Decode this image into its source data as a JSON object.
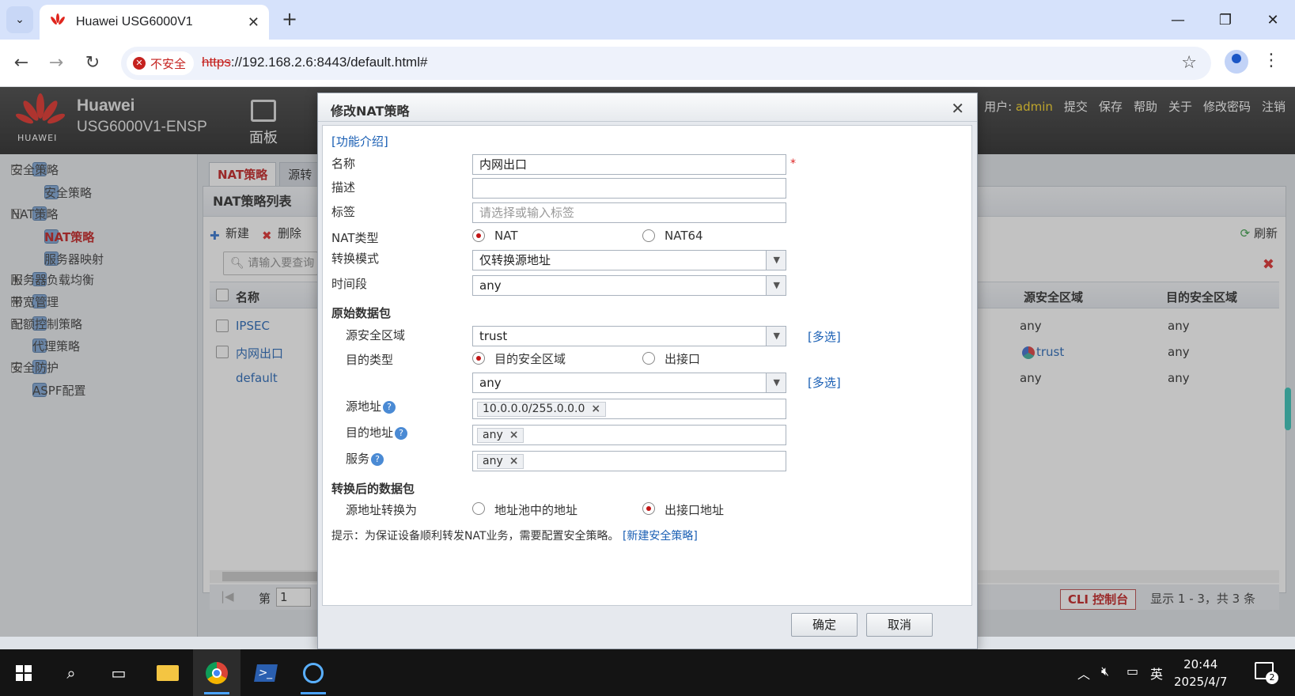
{
  "browser": {
    "tab_title": "Huawei USG6000V1",
    "security_label": "不安全",
    "url_scheme": "https",
    "url_rest": "://192.168.2.6:8443/default.html#"
  },
  "app": {
    "logo_text": "HUAWEI",
    "brand_line1": "Huawei",
    "brand_line2": "USG6000V1-ENSP",
    "panel_label": "面板",
    "user_prefix": "用户:",
    "username": "admin",
    "menu": [
      "提交",
      "保存",
      "帮助",
      "关于",
      "修改密码",
      "注销"
    ]
  },
  "nav": [
    {
      "label": "安全策略",
      "level": 0,
      "toggle": "−"
    },
    {
      "label": "安全策略",
      "level": 1,
      "toggle": ""
    },
    {
      "label": "NAT策略",
      "level": 0,
      "toggle": "−"
    },
    {
      "label": "NAT策略",
      "level": 1,
      "toggle": "",
      "active": true
    },
    {
      "label": "服务器映射",
      "level": 1,
      "toggle": ""
    },
    {
      "label": "服务器负载均衡",
      "level": 0,
      "toggle": "+"
    },
    {
      "label": "带宽管理",
      "level": 0,
      "toggle": "+"
    },
    {
      "label": "配额控制策略",
      "level": 0,
      "toggle": "+"
    },
    {
      "label": "代理策略",
      "level": 0,
      "toggle": ""
    },
    {
      "label": "安全防护",
      "level": 0,
      "toggle": "+"
    },
    {
      "label": "ASPF配置",
      "level": 0,
      "toggle": ""
    }
  ],
  "content": {
    "tabs": [
      "NAT策略",
      "源转"
    ],
    "list_title": "NAT策略列表",
    "tools": {
      "new": "新建",
      "delete": "删除",
      "refresh": "刷新"
    },
    "search_placeholder": "请输入要查询",
    "columns": {
      "name": "名称",
      "src_zone": "源安全区域",
      "dst_zone": "目的安全区域"
    },
    "rows": [
      {
        "name": "IPSEC",
        "src_zone": "any",
        "dst_zone": "any"
      },
      {
        "name": "内网出口",
        "src_zone": "trust",
        "dst_zone": "any"
      },
      {
        "name": "default",
        "src_zone": "any",
        "dst_zone": "any"
      }
    ],
    "pager_prefix": "第",
    "pager_page": "1",
    "pager_summary": "显示 1 - 3，共 3 条",
    "cli_button": "CLI 控制台"
  },
  "dialog": {
    "title": "修改NAT策略",
    "intro_link": "[功能介绍]",
    "name_label": "名称",
    "name_value": "内网出口",
    "required_mark": "*",
    "desc_label": "描述",
    "desc_value": "",
    "tag_label": "标签",
    "tag_placeholder": "请选择或输入标签",
    "nat_type_label": "NAT类型",
    "nat_type_options": [
      "NAT",
      "NAT64"
    ],
    "nat_type_selected": "NAT",
    "mode_label": "转换模式",
    "mode_value": "仅转换源地址",
    "time_label": "时间段",
    "time_value": "any",
    "orig_section": "原始数据包",
    "src_zone_label": "源安全区域",
    "src_zone_value": "trust",
    "multi_link": "[多选]",
    "dst_type_label": "目的类型",
    "dst_type_options": [
      "目的安全区域",
      "出接口"
    ],
    "dst_type_selected": "目的安全区域",
    "dst_zone_value": "any",
    "src_addr_label": "源地址",
    "src_addr_chip": "10.0.0.0/255.0.0.0",
    "dst_addr_label": "目的地址",
    "dst_addr_chip": "any",
    "service_label": "服务",
    "service_chip": "any",
    "help_mark": "?",
    "chip_remove": "×",
    "trans_section": "转换后的数据包",
    "src_trans_label": "源地址转换为",
    "src_trans_options": [
      "地址池中的地址",
      "出接口地址"
    ],
    "src_trans_selected": "出接口地址",
    "tip_text": "提示：为保证设备顺利转发NAT业务，需要配置安全策略。",
    "tip_link": "[新建安全策略]",
    "ok": "确定",
    "cancel": "取消"
  },
  "taskbar": {
    "time": "20:44",
    "date": "2025/4/7",
    "ime": "英",
    "notifications": "2"
  },
  "colors": {
    "accent_red": "#c21515",
    "link_blue": "#1a5fb4",
    "header_dark": "#2b2b2b",
    "username_yellow": "#f7d11a"
  }
}
